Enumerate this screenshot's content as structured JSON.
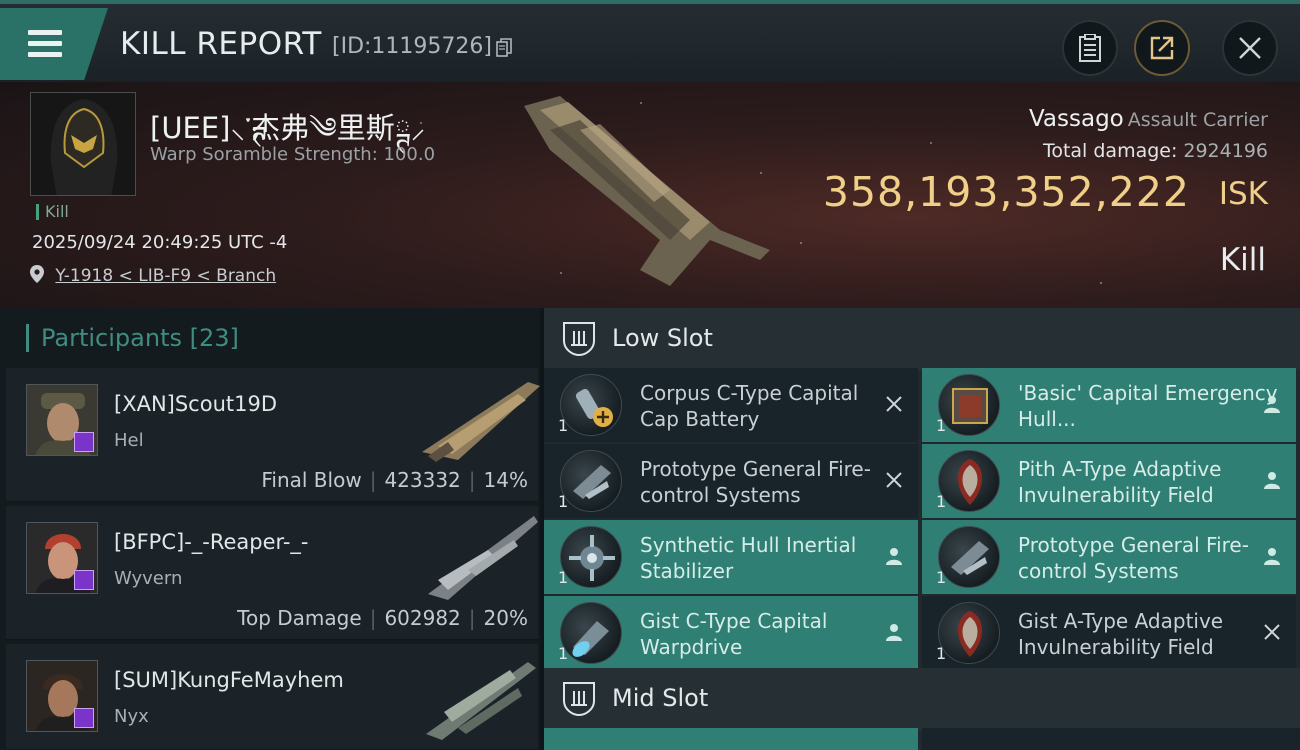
{
  "header": {
    "title": "KILL REPORT",
    "report_id": "[ID:11195726]"
  },
  "victim": {
    "name": "[UEE]⸜་ྚ杰弗༄里斯ྚ⸝",
    "warp_scramble": "Warp Soramble Strength: 100.0",
    "kill_tag": "Kill",
    "timestamp": "2025/09/24 20:49:25 UTC -4",
    "location": "Y-1918 < LIB-F9 < Branch",
    "ship": "Vassago",
    "ship_class": "Assault Carrier",
    "total_damage_label": "Total damage:",
    "total_damage": "2924196",
    "isk_value": "358,193,352,222",
    "isk_unit": "ISK",
    "result": "Kill"
  },
  "participants": {
    "title": "Participants",
    "count": "[23]",
    "rows": [
      {
        "name": "[XAN]Scout19D",
        "ship": "Hel",
        "role": "Final Blow",
        "damage": "423332",
        "percent": "14%"
      },
      {
        "name": "[BFPC]-_-Reaper-_-",
        "ship": "Wyvern",
        "role": "Top Damage",
        "damage": "602982",
        "percent": "20%"
      },
      {
        "name": "[SUM]KungFeMayhem",
        "ship": "Nyx",
        "role": "",
        "damage": "",
        "percent": ""
      }
    ]
  },
  "low_slot": {
    "label": "Low Slot",
    "modules": [
      {
        "name": "Corpus C-Type Capital Cap Battery",
        "qty": "1",
        "status": "destroyed"
      },
      {
        "name": "'Basic' Capital Emergency Hull...",
        "qty": "1",
        "status": "dropped"
      },
      {
        "name": "Prototype General Fire-control Systems",
        "qty": "1",
        "status": "destroyed"
      },
      {
        "name": "Pith A-Type Adaptive Invulnerability Field",
        "qty": "1",
        "status": "dropped"
      },
      {
        "name": "Synthetic Hull Inertial Stabilizer",
        "qty": "1",
        "status": "dropped"
      },
      {
        "name": "Prototype General Fire-control Systems",
        "qty": "1",
        "status": "dropped"
      },
      {
        "name": "Gist C-Type Capital Warpdrive",
        "qty": "1",
        "status": "dropped"
      },
      {
        "name": "Gist A-Type Adaptive Invulnerability Field",
        "qty": "1",
        "status": "destroyed"
      }
    ]
  },
  "mid_slot": {
    "label": "Mid Slot"
  },
  "colors": {
    "accent": "#2f7f74",
    "isk": "#f0cf88",
    "badge": "#7b34c9"
  }
}
